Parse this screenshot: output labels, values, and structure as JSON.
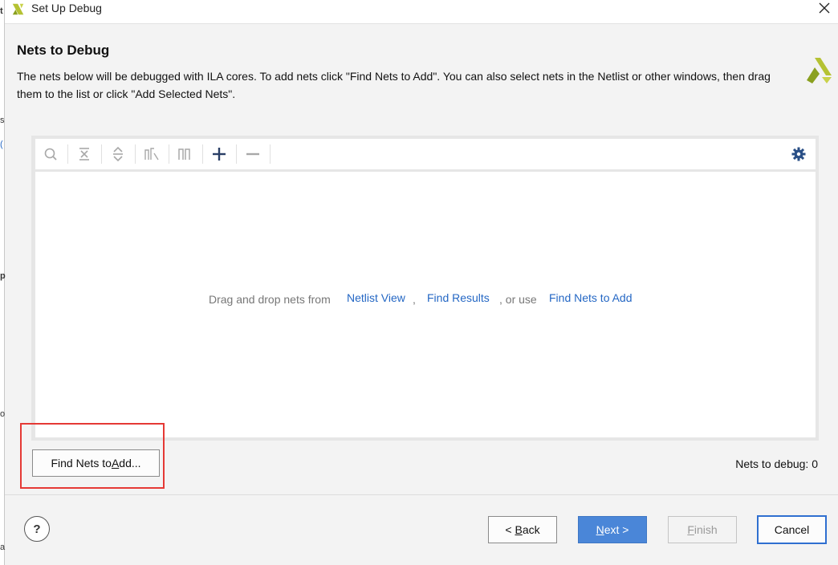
{
  "window": {
    "title": "Set Up Debug",
    "close_label": "Close"
  },
  "behind_glyphs": [
    "t",
    "s",
    "(",
    "p",
    "o",
    "a"
  ],
  "header": {
    "title": "Nets to Debug",
    "description": "The nets below will be debugged with ILA cores. To add nets click \"Find Nets to Add\". You can also select nets in the Netlist or other windows, then drag them to the list or click \"Add Selected Nets\"."
  },
  "toolbar": {
    "icons": [
      "search-icon",
      "collapse-all-icon",
      "expand-all-icon",
      "auto-select-icon",
      "waveform-icon",
      "add-icon",
      "remove-icon",
      "gear-icon"
    ]
  },
  "net_list": {
    "hint_prefix": "Drag and drop nets from",
    "link_netlist": "Netlist View",
    "comma": ",",
    "link_find_results": "Find Results",
    "hint_or": ", or use",
    "link_find_nets": "Find Nets to Add"
  },
  "find_button": {
    "pre": "Find Nets to ",
    "mnemonic": "A",
    "post": "dd..."
  },
  "nets_count": "Nets to debug: 0",
  "footer": {
    "help": "?",
    "back_pre": "< ",
    "back_mnemonic": "B",
    "back_post": "ack",
    "next_mnemonic": "N",
    "next_post": "ext >",
    "finish_mnemonic": "F",
    "finish_post": "inish",
    "cancel": "Cancel"
  },
  "colors": {
    "link": "#2467c4",
    "primary_button": "#4a86d8",
    "highlight_box": "#e53935",
    "brand_logo": "#b5c233"
  }
}
